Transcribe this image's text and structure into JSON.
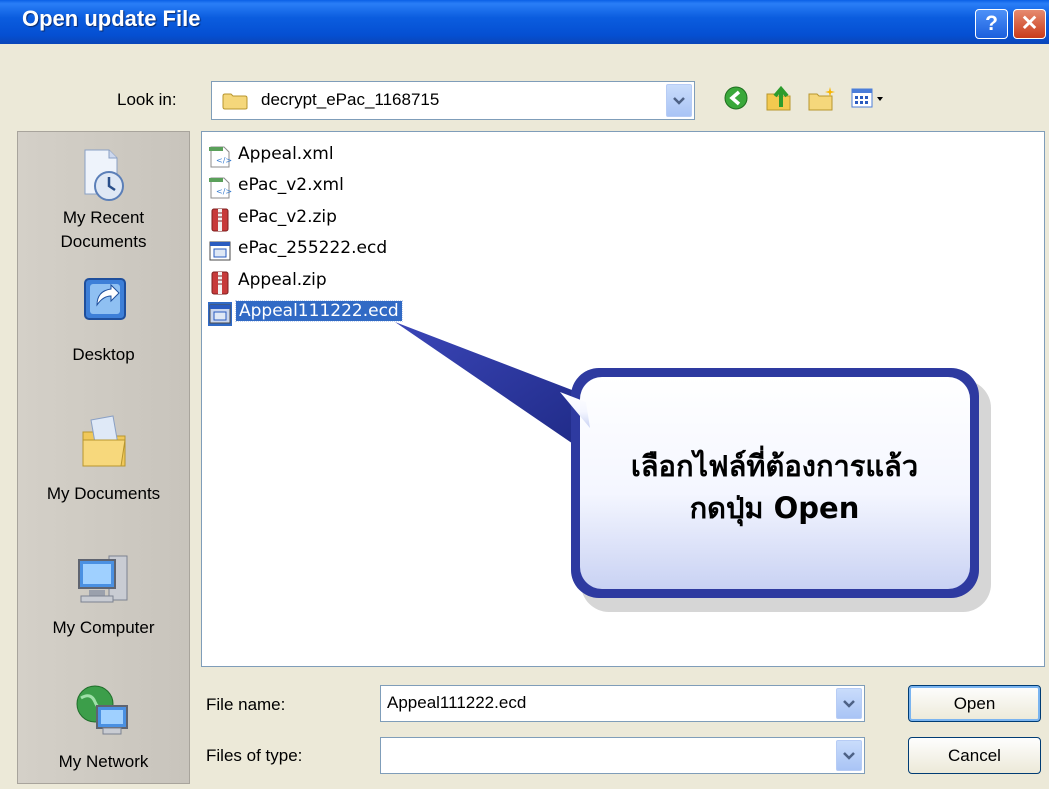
{
  "window": {
    "title": "Open update File",
    "help_label": "?",
    "close_label": "✕"
  },
  "lookin": {
    "label": "Look in:",
    "value": "decrypt_ePac_1168715"
  },
  "toolbar": {
    "back_icon": "back-icon",
    "up_icon": "up-folder-icon",
    "newfolder_icon": "new-folder-icon",
    "views_icon": "views-menu-icon"
  },
  "places": [
    {
      "label": "My Recent\nDocuments",
      "icon": "recent-documents-icon"
    },
    {
      "label": "Desktop",
      "icon": "desktop-icon"
    },
    {
      "label": "My Documents",
      "icon": "my-documents-icon"
    },
    {
      "label": "My Computer",
      "icon": "my-computer-icon"
    },
    {
      "label": "My Network",
      "icon": "my-network-icon"
    }
  ],
  "files": [
    {
      "name": "Appeal.xml",
      "type": "xml"
    },
    {
      "name": "ePac_v2.xml",
      "type": "xml"
    },
    {
      "name": "ePac_v2.zip",
      "type": "zip"
    },
    {
      "name": "ePac_255222.ecd",
      "type": "ecd"
    },
    {
      "name": "Appeal.zip",
      "type": "zip"
    },
    {
      "name": "Appeal111222.ecd",
      "type": "ecd",
      "selected": true
    }
  ],
  "callout": {
    "line1": "เลือกไฟล์ที่ต้องการแล้ว",
    "line2": "กดปุ่ม Open"
  },
  "filename": {
    "label": "File name:",
    "value": "Appeal111222.ecd"
  },
  "filetype": {
    "label": "Files of type:",
    "value": ""
  },
  "buttons": {
    "open": "Open",
    "cancel": "Cancel"
  },
  "colors": {
    "titlebar": "#0054e3",
    "selection": "#316ac5",
    "callout": "#2e3aa0",
    "dialog_bg": "#ece9d8"
  }
}
